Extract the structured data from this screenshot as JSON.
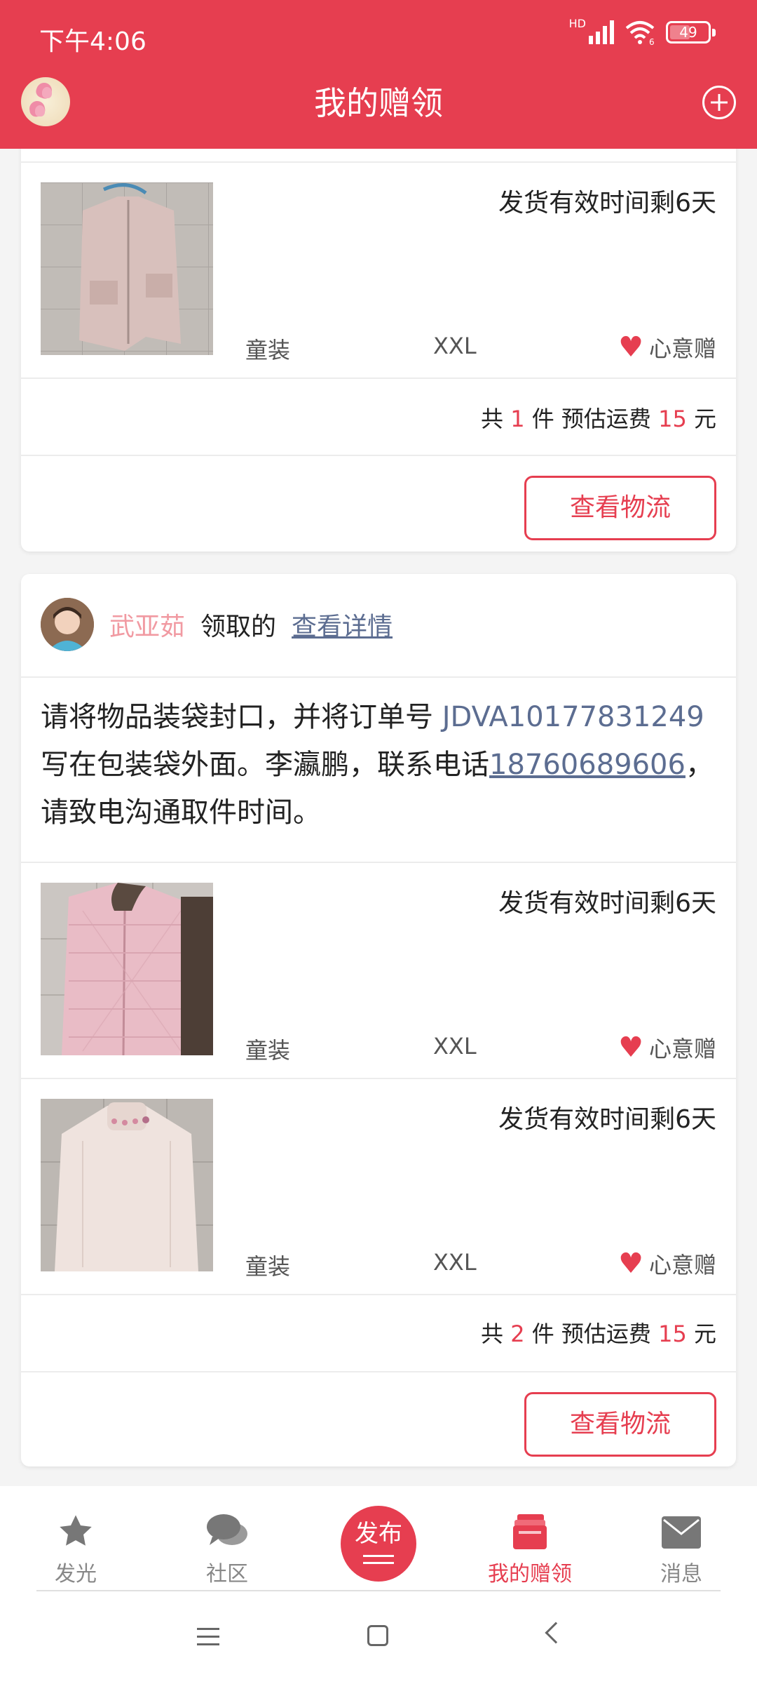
{
  "status_bar": {
    "time": "下午4:06",
    "network": "HD",
    "wifi_badge": "6",
    "battery": "49"
  },
  "header": {
    "title": "我的赠领",
    "avatar_icon": "lotus-avatar",
    "add_icon": "plus-circle-icon"
  },
  "colors": {
    "brand": "#e63e50",
    "link": "#5c6d91",
    "name": "#f19aa2"
  },
  "cards": [
    {
      "items": [
        {
          "deadline": "发货有效时间剩6天",
          "category": "童装",
          "size": "XXL",
          "tag": "心意赠",
          "image": "pink puffer vest"
        }
      ],
      "summary": {
        "prefix": "共",
        "count": "1",
        "mid": "件 预估运费",
        "fee": "15",
        "unit": "元"
      },
      "button": "查看物流"
    },
    {
      "claimer": {
        "name": "武亚茹",
        "action": "领取的",
        "link": "查看详情"
      },
      "instructions": {
        "part1": "请将物品装袋封口，并将订单号 ",
        "order_no": "JDVA10177831249",
        "part2": " 写在包装袋外面。李瀛鹏，联系电话",
        "phone": "18760689606",
        "part3": "，请致电沟通取件时间。"
      },
      "items": [
        {
          "deadline": "发货有效时间剩6天",
          "category": "童装",
          "size": "XXL",
          "tag": "心意赠",
          "image": "pink quilted coat"
        },
        {
          "deadline": "发货有效时间剩6天",
          "category": "童装",
          "size": "XXL",
          "tag": "心意赠",
          "image": "cream turtleneck sweater"
        }
      ],
      "summary": {
        "prefix": "共",
        "count": "2",
        "mid": "件 预估运费",
        "fee": "15",
        "unit": "元"
      },
      "button": "查看物流"
    }
  ],
  "bottom_nav": [
    {
      "label": "发光",
      "icon": "star-icon"
    },
    {
      "label": "社区",
      "icon": "chat-bubbles-icon"
    },
    {
      "label": "发布",
      "icon": "publish-button"
    },
    {
      "label": "我的赠领",
      "icon": "gift-box-icon",
      "active": true
    },
    {
      "label": "消息",
      "icon": "envelope-icon"
    }
  ],
  "system_nav": [
    "menu-icon",
    "home-icon",
    "back-icon"
  ]
}
